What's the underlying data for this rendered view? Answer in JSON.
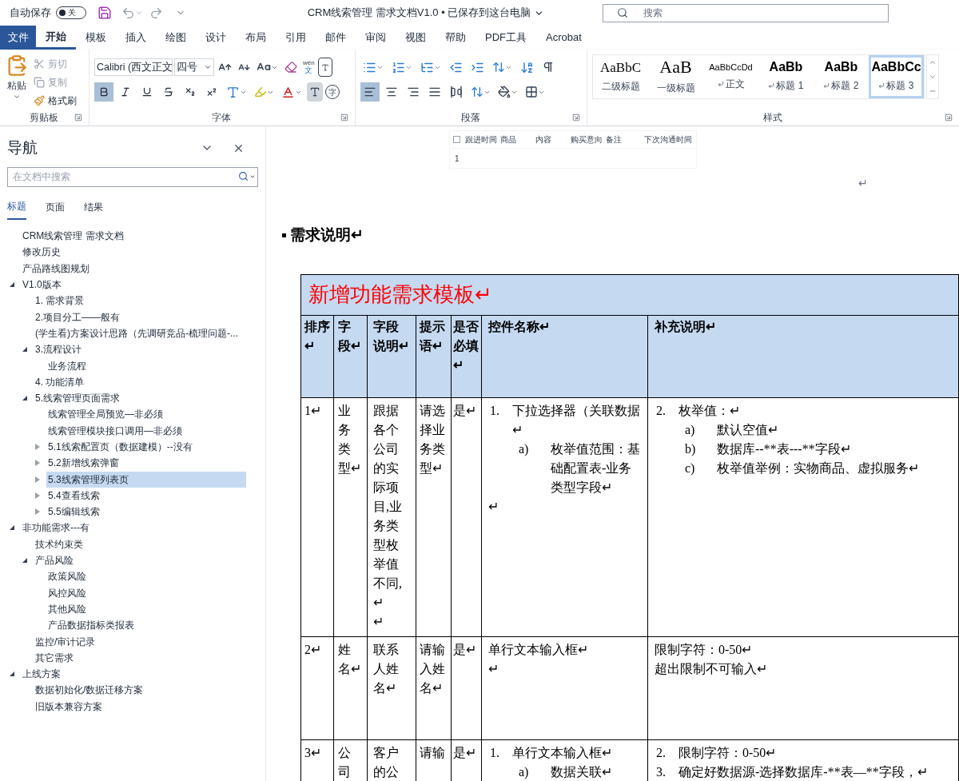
{
  "titlebar": {
    "autosave_label": "自动保存",
    "autosave": {
      "on": false,
      "label": "关"
    },
    "title": "CRM线索管理 需求文档V1.0 • 已保存到这台电脑",
    "search_placeholder": "搜索"
  },
  "ribbon_tabs": {
    "file": "文件",
    "tabs": [
      {
        "label": "开始",
        "selected": true
      },
      {
        "label": "模板",
        "selected": false
      },
      {
        "label": "插入",
        "selected": false
      },
      {
        "label": "绘图",
        "selected": false
      },
      {
        "label": "设计",
        "selected": false
      },
      {
        "label": "布局",
        "selected": false
      },
      {
        "label": "引用",
        "selected": false
      },
      {
        "label": "邮件",
        "selected": false
      },
      {
        "label": "审阅",
        "selected": false
      },
      {
        "label": "视图",
        "selected": false
      },
      {
        "label": "帮助",
        "selected": false
      },
      {
        "label": "PDF工具",
        "selected": false
      },
      {
        "label": "Acrobat",
        "selected": false
      }
    ]
  },
  "clipboard": {
    "label": "剪贴板",
    "paste": "粘贴",
    "items": [
      {
        "kind": "cut",
        "label": "剪切",
        "disabled": true
      },
      {
        "kind": "copy",
        "label": "复制",
        "disabled": true
      },
      {
        "kind": "painter",
        "label": "格式刷",
        "disabled": false
      }
    ]
  },
  "font": {
    "label": "字体",
    "font_name": "Calibri (西文正文",
    "font_size": "四号",
    "phonetic_ruby": "wén",
    "phonetic_base": "文",
    "enclose_char": "字",
    "format_buttons": [
      {
        "kind": "bold",
        "selected": true
      },
      {
        "kind": "italic",
        "selected": false
      },
      {
        "kind": "underline",
        "selected": false
      },
      {
        "kind": "strike",
        "selected": false
      },
      {
        "kind": "sub",
        "selected": false
      },
      {
        "kind": "sup",
        "selected": false
      }
    ]
  },
  "paragraph": {
    "label": "段落",
    "align_buttons": [
      {
        "kind": "left",
        "selected": true
      },
      {
        "kind": "center",
        "selected": false
      },
      {
        "kind": "right",
        "selected": false
      },
      {
        "kind": "justify",
        "selected": false
      },
      {
        "kind": "distributed",
        "selected": false
      }
    ]
  },
  "styles": {
    "label": "样式",
    "items": [
      {
        "preview": "AaBbC",
        "label": "二级标题",
        "linked": false,
        "selected": false
      },
      {
        "preview": "AaB",
        "label": "一级标题",
        "linked": false,
        "selected": false
      },
      {
        "preview": "AaBbCcDd",
        "label": "正文",
        "linked": true,
        "selected": false
      },
      {
        "preview": "AaBb",
        "label": "标题 1",
        "linked": true,
        "selected": false
      },
      {
        "preview": "AaBb",
        "label": "标题 2",
        "linked": true,
        "selected": false
      },
      {
        "preview": "AaBbCc",
        "label": "标题 3",
        "linked": true,
        "selected": true
      }
    ]
  },
  "navigation": {
    "title": "导航",
    "search_placeholder": "在文档中搜索",
    "tabs": [
      {
        "label": "标题",
        "selected": true
      },
      {
        "label": "页面",
        "selected": false
      },
      {
        "label": "结果",
        "selected": false
      }
    ],
    "tree": [
      {
        "label": "CRM线索管理 需求文档",
        "selected": false
      },
      {
        "label": "修改历史",
        "selected": false
      },
      {
        "label": "产品路线图规划",
        "selected": false
      },
      {
        "label": "V1.0版本",
        "selected": false,
        "expanded": true,
        "children": [
          {
            "label": "1. 需求背景",
            "selected": false
          },
          {
            "label": "2.项目分工——般有",
            "selected": false
          },
          {
            "label": "(学生看)方案设计思路（先调研竞品-梳理问题-...",
            "selected": false
          },
          {
            "label": "3.流程设计",
            "selected": false,
            "expanded": true,
            "children": [
              {
                "label": "业务流程",
                "selected": false
              }
            ]
          },
          {
            "label": "4. 功能清单",
            "selected": false
          },
          {
            "label": "5.线索管理页面需求",
            "selected": false,
            "expanded": true,
            "children": [
              {
                "label": "线索管理全局预览—非必须",
                "selected": false
              },
              {
                "label": "线索管理模块接口调用—非必须",
                "selected": false
              },
              {
                "label": "5.1线索配置页（数据建模）--没有",
                "selected": false,
                "expanded": false
              },
              {
                "label": "5.2新增线索弹窗",
                "selected": false,
                "expanded": false
              },
              {
                "label": "5.3线索管理列表页",
                "selected": true,
                "expanded": false
              },
              {
                "label": "5.4查看线索",
                "selected": false,
                "expanded": false
              },
              {
                "label": "5.5编辑线索",
                "selected": false,
                "expanded": false
              }
            ]
          }
        ]
      },
      {
        "label": "非功能需求---有",
        "selected": false,
        "expanded": true,
        "children": [
          {
            "label": "技术约束类",
            "selected": false
          },
          {
            "label": "产品风险",
            "selected": false,
            "expanded": true,
            "children": [
              {
                "label": "政策风险",
                "selected": false
              },
              {
                "label": "风控风险",
                "selected": false
              },
              {
                "label": "其他风险",
                "selected": false
              },
              {
                "label": "产品数据指标类报表",
                "selected": false
              }
            ]
          },
          {
            "label": "监控/审计记录",
            "selected": false
          },
          {
            "label": "其它需求",
            "selected": false
          }
        ]
      },
      {
        "label": "上线方案",
        "selected": false,
        "expanded": true,
        "children": [
          {
            "label": "数据初始化/数据迁移方案",
            "selected": false
          },
          {
            "label": "旧版本兼容方案",
            "selected": false
          }
        ]
      }
    ]
  },
  "document": {
    "mini_table": {
      "checked": false,
      "columns": [
        "跟进时间",
        "商品",
        "内容",
        "购买意向",
        "备注",
        "下次沟通时间"
      ],
      "rows": [
        [
          "1",
          "",
          "",
          "",
          "",
          "",
          ""
        ]
      ]
    },
    "image_mark": "↵",
    "heading": "需求说明↵",
    "table": {
      "title": "新增功能需求模板↵",
      "columns": [
        "排序↵",
        "字段↵",
        "字段说明↵",
        "提示语↵",
        "是否必填↵",
        "控件名称↵",
        "补充说明↵"
      ],
      "rows": [
        [
          [
            {
              "kind": "plain",
              "text": "1↵"
            }
          ],
          [
            {
              "kind": "plain",
              "text": "业务类型↵"
            }
          ],
          [
            {
              "kind": "plain",
              "text": "跟据各个公司的实际项目,业务类型枚举值不同,↵"
            },
            {
              "kind": "plain",
              "text": "↵"
            }
          ],
          [
            {
              "kind": "plain",
              "text": "请选择业务类型↵"
            }
          ],
          [
            {
              "kind": "plain",
              "text": "是↵"
            }
          ],
          [
            {
              "kind": "level1",
              "number": "1.",
              "text": "下拉选择器（关联数据↵"
            },
            {
              "kind": "level2",
              "number": "a)",
              "text": "枚举值范围：基础配置表-业务类型字段↵"
            },
            {
              "kind": "plain",
              "text": "↵"
            }
          ],
          [
            {
              "kind": "level1",
              "number": "2.",
              "text": "枚举值：↵"
            },
            {
              "kind": "level2",
              "number": "a)",
              "text": "默认空值↵"
            },
            {
              "kind": "level2",
              "number": "b)",
              "text": "数据库--**表---**字段↵"
            },
            {
              "kind": "level2",
              "number": "c)",
              "text": "枚举值举例：实物商品、虚拟服务↵"
            }
          ]
        ],
        [
          [
            {
              "kind": "plain",
              "text": "2↵"
            }
          ],
          [
            {
              "kind": "plain",
              "text": "姓名↵"
            }
          ],
          [
            {
              "kind": "plain",
              "text": "联系人姓名↵"
            }
          ],
          [
            {
              "kind": "plain",
              "text": "请输入姓名↵"
            }
          ],
          [
            {
              "kind": "plain",
              "text": "是↵"
            }
          ],
          [
            {
              "kind": "plain",
              "text": "单行文本输入框↵"
            },
            {
              "kind": "plain",
              "text": "↵"
            }
          ],
          [
            {
              "kind": "plain",
              "text": "限制字符：0-50↵"
            },
            {
              "kind": "plain",
              "text": "超出限制不可输入↵"
            }
          ]
        ],
        [
          [
            {
              "kind": "plain",
              "text": "3↵"
            }
          ],
          [
            {
              "kind": "plain",
              "text": "公司"
            }
          ],
          [
            {
              "kind": "plain",
              "text": "客户的公"
            }
          ],
          [
            {
              "kind": "plain",
              "text": "请输"
            }
          ],
          [
            {
              "kind": "plain",
              "text": "是↵"
            }
          ],
          [
            {
              "kind": "level1",
              "number": "1.",
              "text": "单行文本输入框↵"
            },
            {
              "kind": "level2",
              "number": "a)",
              "text": "数据关联↵"
            }
          ],
          [
            {
              "kind": "level1",
              "number": "2.",
              "text": "限制字符：0-50↵"
            },
            {
              "kind": "level1",
              "number": "3.",
              "text": "确定好数据源-选择数据库-**表—**字段，↵"
            }
          ]
        ]
      ]
    }
  }
}
